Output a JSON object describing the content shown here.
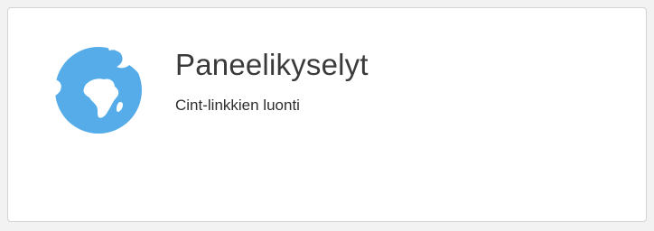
{
  "card": {
    "title": "Paneelikyselyt",
    "subtitle": "Cint-linkkien luonti",
    "icon": "globe-icon",
    "accent_color": "#55ace8"
  }
}
